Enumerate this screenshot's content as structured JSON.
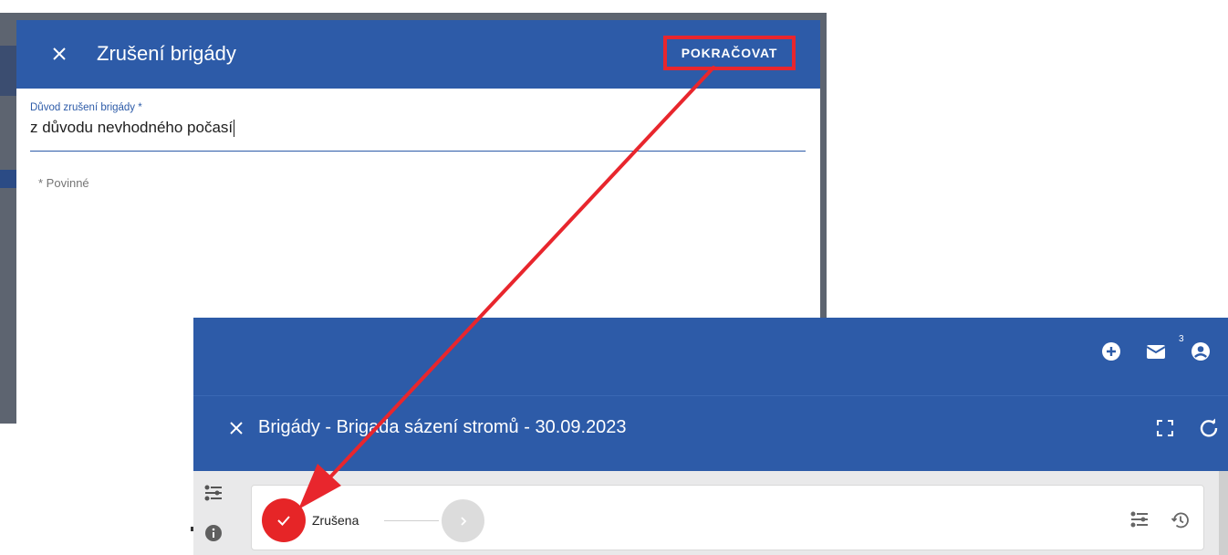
{
  "dialog": {
    "title": "Zrušení brigády",
    "continue_label": "POKRAČOVAT",
    "field_label": "Důvod zrušení brigády *",
    "field_value": "z důvodu nevhodného počasí",
    "required_note": "* Povinné"
  },
  "panel": {
    "mail_badge": "3",
    "title": "Brigády - Brigada sázení stromů - 30.09.2023",
    "status": {
      "step_label": "Zrušena"
    }
  },
  "colors": {
    "header_blue": "#2d5ba8",
    "annotation_red": "#e8262d",
    "step_done_red": "#e62527"
  },
  "icons": [
    "close-icon",
    "add-circle-icon",
    "mail-icon",
    "account-icon",
    "fullscreen-icon",
    "refresh-icon",
    "filter-list-icon",
    "info-icon",
    "check-icon",
    "chevron-right-icon",
    "history-icon"
  ]
}
